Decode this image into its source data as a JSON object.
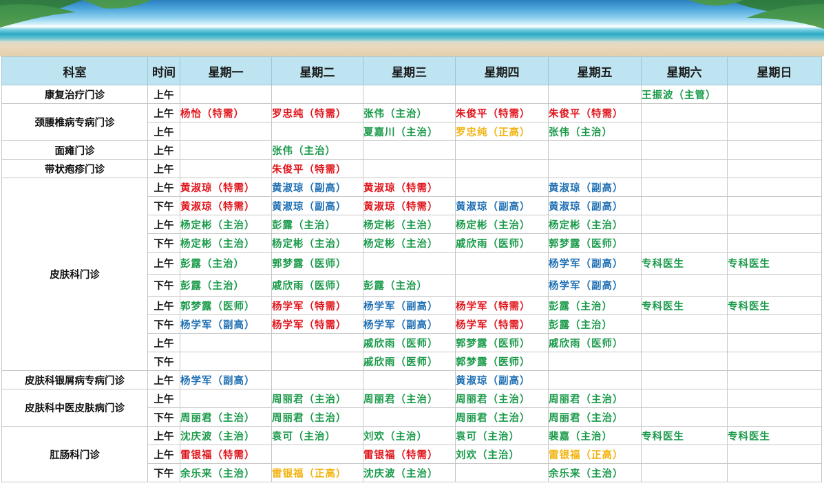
{
  "header": {
    "dept": "科室",
    "time": "时间",
    "days": [
      "星期一",
      "星期二",
      "星期三",
      "星期四",
      "星期五",
      "星期六",
      "星期日"
    ]
  },
  "colors": {
    "red": "#e0161d",
    "green": "#1a9a4a",
    "blue": "#1f6fb3",
    "orange": "#f2b30d"
  },
  "departments": [
    {
      "name": "康复治疗门诊",
      "rows": [
        {
          "time": "上午",
          "cells": [
            null,
            null,
            null,
            null,
            null,
            {
              "t": "王振波（主管）",
              "c": "green"
            },
            null
          ]
        }
      ]
    },
    {
      "name": "颈腰椎病专病门诊",
      "rows": [
        {
          "time": "上午",
          "cells": [
            {
              "t": "杨怡（特需）",
              "c": "red"
            },
            {
              "t": "罗忠纯（特需）",
              "c": "red"
            },
            {
              "t": "张伟（主治）",
              "c": "green"
            },
            {
              "t": "朱俊平（特需）",
              "c": "red"
            },
            {
              "t": "朱俊平（特需）",
              "c": "red"
            },
            null,
            null
          ]
        },
        {
          "time": "上午",
          "cells": [
            null,
            null,
            {
              "t": "夏嘉川（主治）",
              "c": "green"
            },
            {
              "t": "罗忠纯（正高）",
              "c": "orange"
            },
            {
              "t": "张伟（主治）",
              "c": "green"
            },
            null,
            null
          ]
        }
      ]
    },
    {
      "name": "面瘫门诊",
      "rows": [
        {
          "time": "上午",
          "cells": [
            null,
            {
              "t": "张伟（主治）",
              "c": "green"
            },
            null,
            null,
            null,
            null,
            null
          ]
        }
      ]
    },
    {
      "name": "带状疱疹门诊",
      "rows": [
        {
          "time": "上午",
          "cells": [
            null,
            {
              "t": "朱俊平（特需）",
              "c": "red"
            },
            null,
            null,
            null,
            null,
            null
          ]
        }
      ]
    },
    {
      "name": "皮肤科门诊",
      "rows": [
        {
          "time": "上午",
          "cells": [
            {
              "t": "黄淑琼（特需）",
              "c": "red"
            },
            {
              "t": "黄淑琼（副高）",
              "c": "blue"
            },
            {
              "t": "黄淑琼（特需）",
              "c": "red"
            },
            null,
            {
              "t": "黄淑琼（副高）",
              "c": "blue"
            },
            null,
            null
          ]
        },
        {
          "time": "下午",
          "cells": [
            {
              "t": "黄淑琼（特需）",
              "c": "red"
            },
            {
              "t": "黄淑琼（副高）",
              "c": "blue"
            },
            {
              "t": "黄淑琼（特需）",
              "c": "red"
            },
            {
              "t": "黄淑琼（副高）",
              "c": "blue"
            },
            {
              "t": "黄淑琼（副高）",
              "c": "blue"
            },
            null,
            null
          ]
        },
        {
          "time": "上午",
          "cells": [
            {
              "t": "杨定彬（主治）",
              "c": "green"
            },
            {
              "t": "彭露（主治）",
              "c": "green"
            },
            {
              "t": "杨定彬（主治）",
              "c": "green"
            },
            {
              "t": "杨定彬（主治）",
              "c": "green"
            },
            {
              "t": "杨定彬（主治）",
              "c": "green"
            },
            null,
            null
          ]
        },
        {
          "time": "下午",
          "cells": [
            {
              "t": "杨定彬（主治）",
              "c": "green"
            },
            {
              "t": "杨定彬（主治）",
              "c": "green"
            },
            {
              "t": "杨定彬（主治）",
              "c": "green"
            },
            {
              "t": "戚欣雨（医师）",
              "c": "green"
            },
            {
              "t": "郭梦露（医师）",
              "c": "green"
            },
            null,
            null
          ]
        },
        {
          "time": "上午",
          "tall": true,
          "cells": [
            {
              "t": "彭露（主治）",
              "c": "green"
            },
            {
              "t": "郭梦露（医师）",
              "c": "green"
            },
            null,
            null,
            {
              "t": "杨学军（副高）",
              "c": "blue"
            },
            {
              "t": "专科医生",
              "c": "green"
            },
            {
              "t": "专科医生",
              "c": "green"
            }
          ]
        },
        {
          "time": "下午",
          "tall": true,
          "cells": [
            {
              "t": "彭露（主治）",
              "c": "green"
            },
            {
              "t": "戚欣雨（医师）",
              "c": "green"
            },
            {
              "t": "彭露（主治）",
              "c": "green"
            },
            null,
            {
              "t": "杨学军（副高）",
              "c": "blue"
            },
            null,
            null
          ]
        },
        {
          "time": "上午",
          "cells": [
            {
              "t": "郭梦露（医师）",
              "c": "green"
            },
            {
              "t": "杨学军（特需）",
              "c": "red"
            },
            {
              "t": "杨学军（副高）",
              "c": "blue"
            },
            {
              "t": "杨学军（特需）",
              "c": "red"
            },
            {
              "t": "彭露（主治）",
              "c": "green"
            },
            {
              "t": "专科医生",
              "c": "green"
            },
            {
              "t": "专科医生",
              "c": "green"
            }
          ]
        },
        {
          "time": "下午",
          "cells": [
            {
              "t": "杨学军（副高）",
              "c": "blue"
            },
            {
              "t": "杨学军（特需）",
              "c": "red"
            },
            {
              "t": "杨学军（副高）",
              "c": "blue"
            },
            {
              "t": "杨学军（特需）",
              "c": "red"
            },
            {
              "t": "彭露（主治）",
              "c": "green"
            },
            null,
            null
          ]
        },
        {
          "time": "上午",
          "cells": [
            null,
            null,
            {
              "t": "戚欣雨（医师）",
              "c": "green"
            },
            {
              "t": "郭梦露（医师）",
              "c": "green"
            },
            {
              "t": "戚欣雨（医师）",
              "c": "green"
            },
            null,
            null
          ]
        },
        {
          "time": "下午",
          "cells": [
            null,
            null,
            {
              "t": "戚欣雨（医师）",
              "c": "green"
            },
            {
              "t": "郭梦露（医师）",
              "c": "green"
            },
            null,
            null,
            null
          ]
        }
      ]
    },
    {
      "name": "皮肤科银屑病专病门诊",
      "rows": [
        {
          "time": "上午",
          "cells": [
            {
              "t": "杨学军（副高）",
              "c": "blue"
            },
            null,
            null,
            {
              "t": "黄淑琼（副高）",
              "c": "blue"
            },
            null,
            null,
            null
          ]
        }
      ]
    },
    {
      "name": "皮肤科中医皮肤病门诊",
      "rows": [
        {
          "time": "上午",
          "cells": [
            null,
            {
              "t": "周丽君（主治）",
              "c": "green"
            },
            {
              "t": "周丽君（主治）",
              "c": "green"
            },
            {
              "t": "周丽君（主治）",
              "c": "green"
            },
            {
              "t": "周丽君（主治）",
              "c": "green"
            },
            null,
            null
          ]
        },
        {
          "time": "下午",
          "cells": [
            {
              "t": "周丽君（主治）",
              "c": "green"
            },
            {
              "t": "周丽君（主治）",
              "c": "green"
            },
            null,
            {
              "t": "周丽君（主治）",
              "c": "green"
            },
            {
              "t": "周丽君（主治）",
              "c": "green"
            },
            null,
            null
          ]
        }
      ]
    },
    {
      "name": "肛肠科门诊",
      "rows": [
        {
          "time": "上午",
          "cells": [
            {
              "t": "沈庆波（主治）",
              "c": "green"
            },
            {
              "t": "袁可（主治）",
              "c": "green"
            },
            {
              "t": "刘欢（主治）",
              "c": "green"
            },
            {
              "t": "袁可（主治）",
              "c": "green"
            },
            {
              "t": "裴嘉（主治）",
              "c": "green"
            },
            {
              "t": "专科医生",
              "c": "green"
            },
            {
              "t": "专科医生",
              "c": "green"
            }
          ]
        },
        {
          "time": "上午",
          "cells": [
            {
              "t": "雷银福（特需）",
              "c": "red"
            },
            null,
            {
              "t": "雷银福（特需）",
              "c": "red"
            },
            {
              "t": "刘欢（主治）",
              "c": "green"
            },
            {
              "t": "雷银福（正高）",
              "c": "orange"
            },
            null,
            null
          ]
        },
        {
          "time": "下午",
          "cells": [
            {
              "t": "余乐来（主治）",
              "c": "green"
            },
            {
              "t": "雷银福（正高）",
              "c": "orange"
            },
            {
              "t": "沈庆波（主治）",
              "c": "green"
            },
            null,
            {
              "t": "余乐来（主治）",
              "c": "green"
            },
            null,
            null
          ]
        }
      ]
    }
  ]
}
